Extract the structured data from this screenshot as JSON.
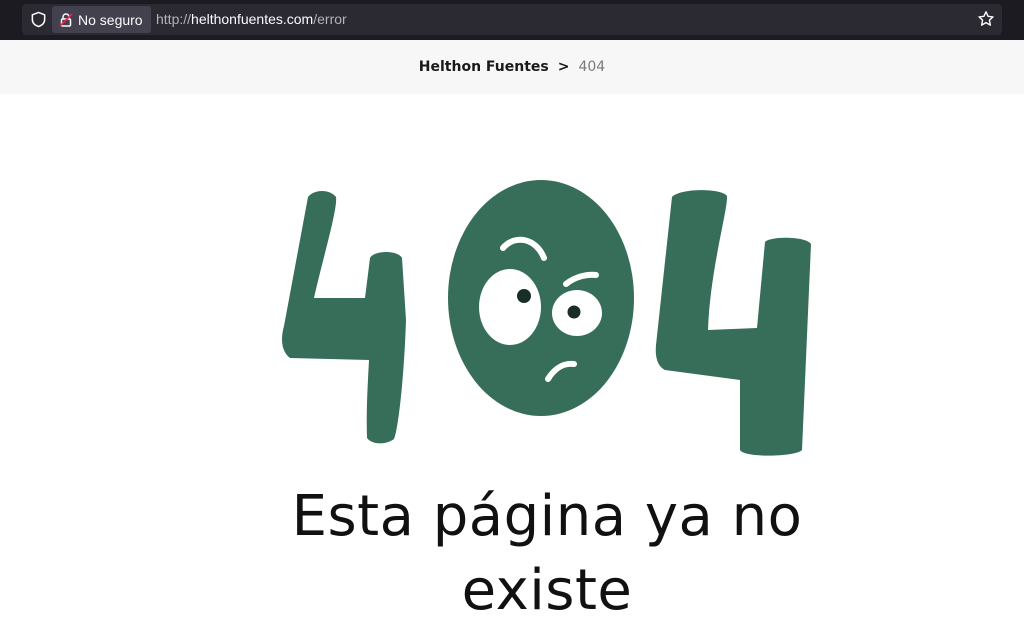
{
  "browser": {
    "security_label": "No seguro",
    "url_scheme": "http://",
    "url_host": "helthonfuentes.com",
    "url_path": "/error",
    "icons": {
      "shield": "shield-icon",
      "lock": "lock-warning-icon",
      "bookmark": "star-icon"
    }
  },
  "breadcrumb": {
    "home": "Helthon Fuentes",
    "separator": ">",
    "current": "404"
  },
  "error": {
    "illustration_text": "404",
    "message": "Esta página ya no existe"
  },
  "colors": {
    "brand_green": "#366e5a",
    "browser_bg": "#1c1b22",
    "breadcrumb_bg": "#f7f7f7"
  }
}
